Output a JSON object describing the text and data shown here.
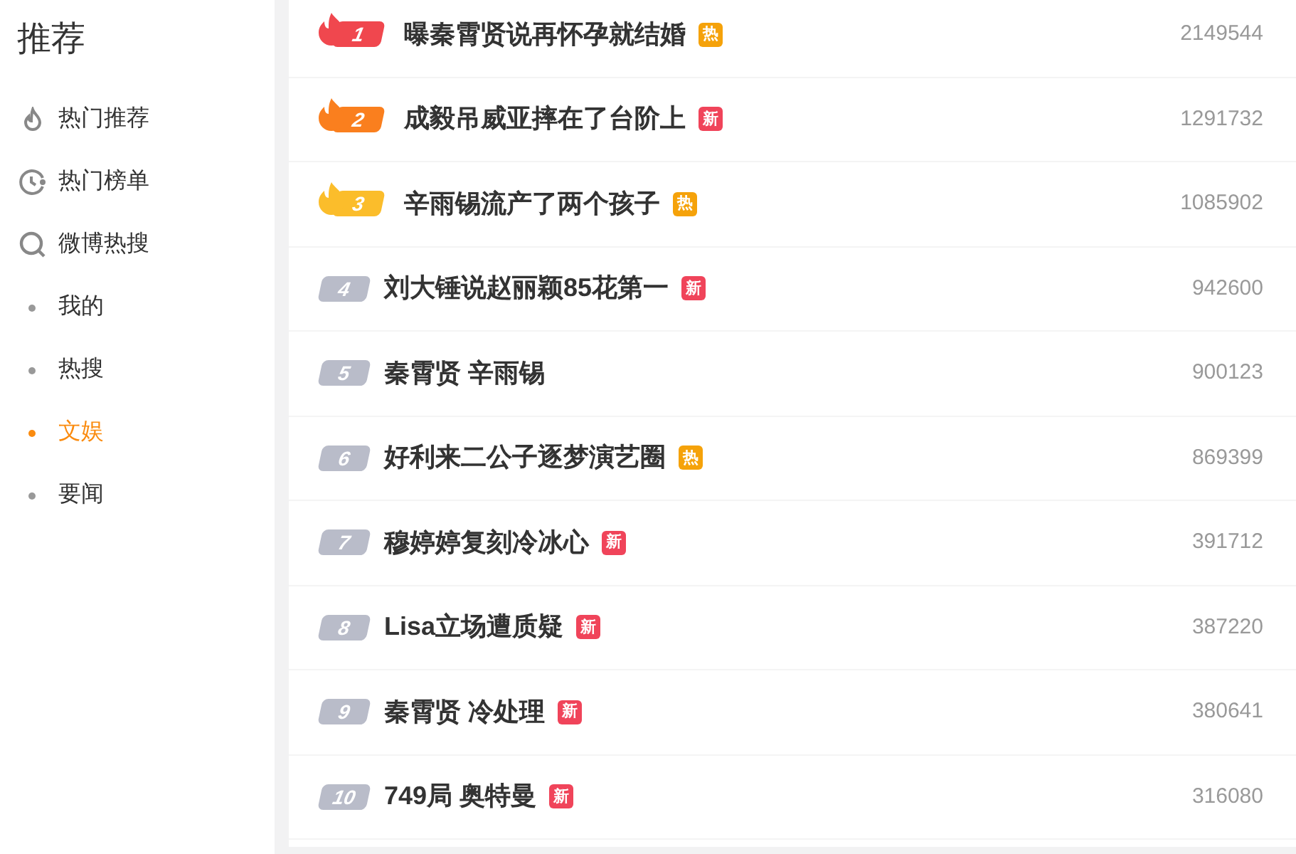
{
  "sidebar": {
    "title": "推荐",
    "items": [
      {
        "label": "热门推荐",
        "kind": "flame",
        "selected": false
      },
      {
        "label": "热门榜单",
        "kind": "clock",
        "selected": false
      },
      {
        "label": "微博热搜",
        "kind": "search",
        "selected": false
      },
      {
        "label": "我的",
        "kind": "bullet",
        "selected": false
      },
      {
        "label": "热搜",
        "kind": "bullet",
        "selected": false
      },
      {
        "label": "文娱",
        "kind": "bullet",
        "selected": true
      },
      {
        "label": "要闻",
        "kind": "bullet",
        "selected": false
      }
    ]
  },
  "hot_list": [
    {
      "rank": "1",
      "kind": "flame",
      "color": "#f0474e",
      "title": "曝秦霄贤说再怀孕就结婚",
      "tag": {
        "label": "热",
        "kind": "hot"
      },
      "count": "2149544"
    },
    {
      "rank": "2",
      "kind": "flame",
      "color": "#fa7f1e",
      "title": "成毅吊威亚摔在了台阶上",
      "tag": {
        "label": "新",
        "kind": "new"
      },
      "count": "1291732"
    },
    {
      "rank": "3",
      "kind": "flame",
      "color": "#fbbd2b",
      "title": "辛雨锡流产了两个孩子",
      "tag": {
        "label": "热",
        "kind": "hot"
      },
      "count": "1085902"
    },
    {
      "rank": "4",
      "kind": "plain",
      "color": "#b9bcc9",
      "title": "刘大锤说赵丽颖85花第一",
      "tag": {
        "label": "新",
        "kind": "new"
      },
      "count": "942600"
    },
    {
      "rank": "5",
      "kind": "plain",
      "color": "#b9bcc9",
      "title": "秦霄贤 辛雨锡",
      "count": "900123"
    },
    {
      "rank": "6",
      "kind": "plain",
      "color": "#b9bcc9",
      "title": "好利来二公子逐梦演艺圈",
      "tag": {
        "label": "热",
        "kind": "hot"
      },
      "count": "869399"
    },
    {
      "rank": "7",
      "kind": "plain",
      "color": "#b9bcc9",
      "title": "穆婷婷复刻冷冰心",
      "tag": {
        "label": "新",
        "kind": "new"
      },
      "count": "391712"
    },
    {
      "rank": "8",
      "kind": "plain",
      "color": "#b9bcc9",
      "title": "Lisa立场遭质疑",
      "tag": {
        "label": "新",
        "kind": "new"
      },
      "count": "387220"
    },
    {
      "rank": "9",
      "kind": "plain",
      "color": "#b9bcc9",
      "title": "秦霄贤 冷处理",
      "tag": {
        "label": "新",
        "kind": "new"
      },
      "count": "380641"
    },
    {
      "rank": "10",
      "kind": "plain",
      "color": "#b9bcc9",
      "title": "749局 奥特曼",
      "tag": {
        "label": "新",
        "kind": "new"
      },
      "count": "316080"
    }
  ]
}
